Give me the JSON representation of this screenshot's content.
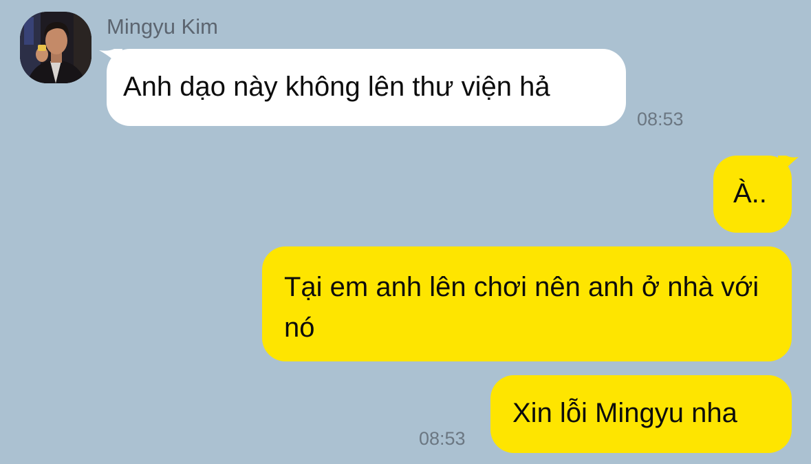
{
  "chat": {
    "background_color": "#abc1d1",
    "incoming_bubble_color": "#ffffff",
    "outgoing_bubble_color": "#fee500",
    "sender": {
      "name": "Mingyu Kim",
      "avatar": "profile-photo"
    },
    "messages": [
      {
        "direction": "incoming",
        "text": "Anh dạo này không lên thư viện hả",
        "time": "08:53"
      },
      {
        "direction": "outgoing",
        "text": "À.."
      },
      {
        "direction": "outgoing",
        "text": "Tại em anh lên chơi nên anh ở nhà với nó"
      },
      {
        "direction": "outgoing",
        "text": "Xin lỗi Mingyu nha",
        "time": "08:53"
      }
    ]
  }
}
